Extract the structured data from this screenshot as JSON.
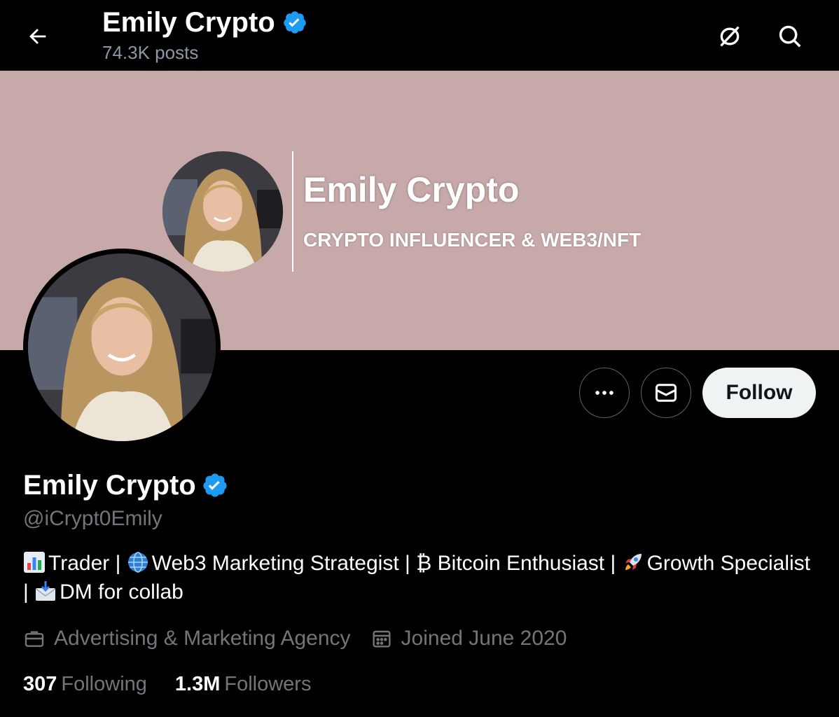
{
  "header": {
    "title": "Emily Crypto",
    "post_count": "74.3K posts"
  },
  "banner": {
    "name": "Emily Crypto",
    "subtitle": "CRYPTO INFLUENCER & WEB3/NFT"
  },
  "actions": {
    "follow_label": "Follow"
  },
  "profile": {
    "display_name": "Emily Crypto",
    "handle": "@iCrypt0Emily",
    "bio": {
      "part1": "Trader | ",
      "part2": "Web3 Marketing Strategist | ₿ Bitcoin Enthusiast | ",
      "part3": "Growth Specialist | ",
      "part4": "DM for collab"
    },
    "category": "Advertising & Marketing Agency",
    "joined": "Joined June 2020",
    "following_count": "307",
    "following_label": "Following",
    "followers_count": "1.3M",
    "followers_label": "Followers"
  },
  "colors": {
    "background": "#000000",
    "banner": "#c6a9a8",
    "verified": "#1d9bf0",
    "muted_text": "#71767b",
    "follow_button": "#eff3f4"
  },
  "icons": [
    "back-arrow-icon",
    "verified-badge-icon",
    "hide-icon",
    "search-icon",
    "more-icon",
    "mail-icon",
    "briefcase-icon",
    "calendar-icon",
    "bar-chart-emoji",
    "globe-emoji",
    "rocket-emoji",
    "envelope-emoji"
  ]
}
